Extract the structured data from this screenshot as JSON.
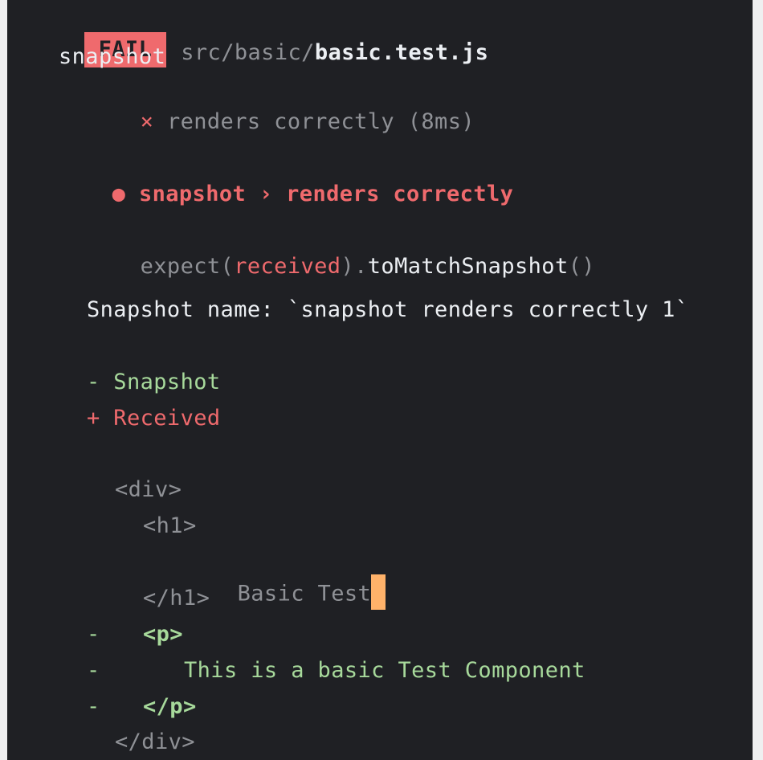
{
  "header": {
    "badge": "FAIL",
    "path_prefix": "src/basic/",
    "file_name": "basic.test.js"
  },
  "suite": {
    "name": "snapshot",
    "test_mark": "×",
    "test_result": "renders correctly (8ms)"
  },
  "failure": {
    "bullet": "●",
    "title": "snapshot › renders correctly"
  },
  "assertion": {
    "expect": "expect(",
    "received": "received",
    "close": ")",
    "dot": ".",
    "matcher": "toMatchSnapshot",
    "parens": "()"
  },
  "snapshot_name": "Snapshot name: `snapshot renders correctly 1`",
  "legend": {
    "minus_label": "- Snapshot",
    "plus_label": "+ Received"
  },
  "diff": {
    "div_open": "<div>",
    "h1_open": "<h1>",
    "h1_text": "Basic Test",
    "h1_close": "</h1>",
    "p_open_sign": "-",
    "p_open": "<p>",
    "p_text_sign": "-",
    "p_text": "This is a basic Test Component",
    "p_close_sign": "-",
    "p_close": "</p>",
    "div_close": "</div>"
  },
  "colors": {
    "background": "#1f2024",
    "fail": "#ef6a6d",
    "green": "#a7d99b",
    "cursor": "#ffb26a",
    "dim": "#8f9196",
    "text": "#eceff3"
  }
}
